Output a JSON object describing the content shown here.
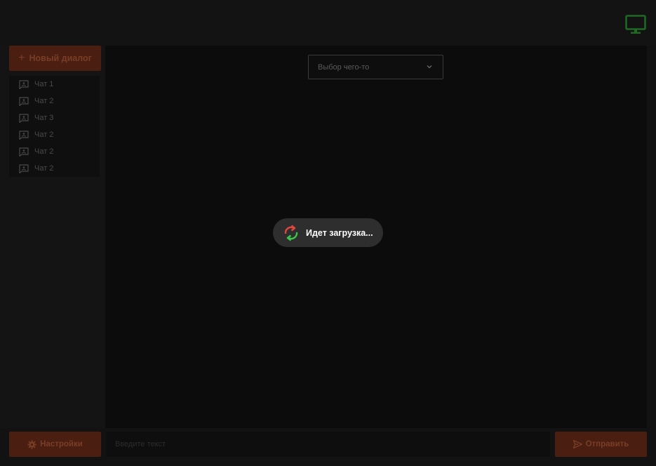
{
  "header": {
    "monitor_icon": "monitor-icon"
  },
  "sidebar": {
    "new_dialog_label": "Новый диалог",
    "chats": [
      {
        "label": "Чат 1"
      },
      {
        "label": "Чат 2"
      },
      {
        "label": "Чат 3"
      },
      {
        "label": "Чат 2"
      },
      {
        "label": "Чат 2"
      },
      {
        "label": "Чат 2"
      }
    ]
  },
  "main": {
    "select": {
      "value": "Выбор чего-то"
    },
    "loading_text": "Идет загрузка..."
  },
  "footer": {
    "settings_label": "Настройки",
    "input_placeholder": "Введите текст",
    "send_label": "Отправить"
  },
  "colors": {
    "accent": "#4a1e10",
    "accent_text": "#7a3d26",
    "monitor": "#1f7a26",
    "spinner_red": "#e0463c",
    "spinner_green": "#3cc44a"
  }
}
